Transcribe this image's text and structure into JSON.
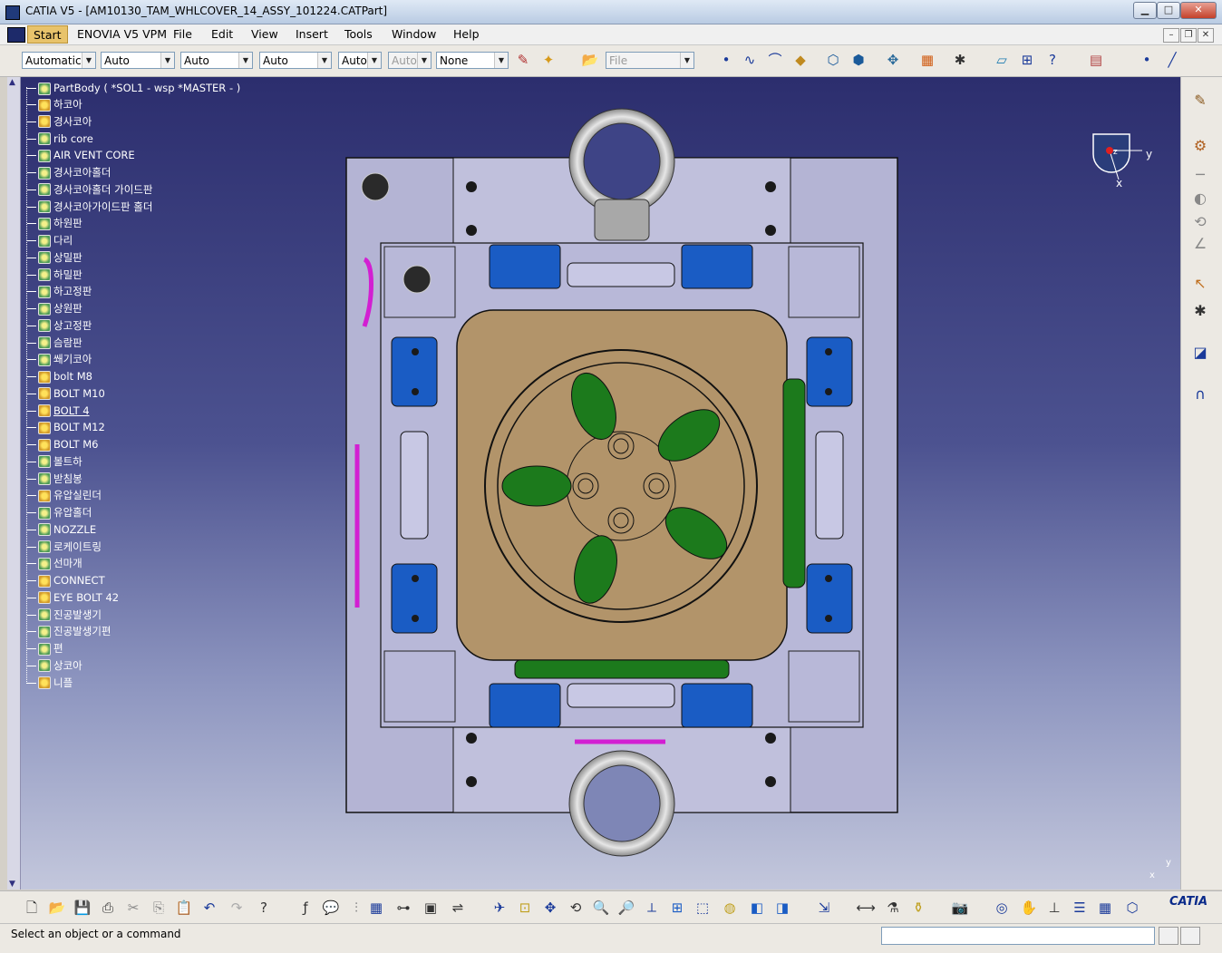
{
  "window": {
    "title": "CATIA V5 - [AM10130_TAM_WHLCOVER_14_ASSY_101224.CATPart]",
    "min_label": "▁",
    "max_label": "□",
    "close_label": "✕"
  },
  "menu": {
    "items": [
      "Start",
      "ENOVIA V5 VPM",
      "File",
      "Edit",
      "View",
      "Insert",
      "Tools",
      "Window",
      "Help"
    ]
  },
  "mdi": {
    "min": "–",
    "restore": "❐",
    "close": "✕"
  },
  "toolbar": {
    "combos": [
      "Automatic",
      "Auto",
      "Auto",
      "Auto",
      "Auto",
      "Auto",
      "None",
      "File"
    ]
  },
  "tree": {
    "root": "PartBody ( *SOL1 - wsp *MASTER -  )",
    "items": [
      {
        "label": "하코아",
        "icon": "yellow"
      },
      {
        "label": "경사코아",
        "icon": "yellow"
      },
      {
        "label": "rib core",
        "icon": "green"
      },
      {
        "label": "AIR VENT CORE",
        "icon": "green"
      },
      {
        "label": "경사코아홀더",
        "icon": "green"
      },
      {
        "label": "경사코아홀더 가이드판",
        "icon": "green"
      },
      {
        "label": "경사코아가이드판 홀더",
        "icon": "green"
      },
      {
        "label": "하원판",
        "icon": "green"
      },
      {
        "label": "다리",
        "icon": "green"
      },
      {
        "label": "상밀판",
        "icon": "green"
      },
      {
        "label": "하밀판",
        "icon": "green"
      },
      {
        "label": "하고정판",
        "icon": "green"
      },
      {
        "label": "상원판",
        "icon": "green"
      },
      {
        "label": "상고정판",
        "icon": "green"
      },
      {
        "label": "슴람판",
        "icon": "green"
      },
      {
        "label": "쐐기코아",
        "icon": "green"
      },
      {
        "label": "bolt M8",
        "icon": "yellow"
      },
      {
        "label": "BOLT M10",
        "icon": "yellow"
      },
      {
        "label": "BOLT 4",
        "icon": "yellow"
      },
      {
        "label": "BOLT M12",
        "icon": "yellow"
      },
      {
        "label": "BOLT M6",
        "icon": "yellow"
      },
      {
        "label": "볼트하",
        "icon": "green"
      },
      {
        "label": "받침봉",
        "icon": "green"
      },
      {
        "label": "유압실린더",
        "icon": "yellow"
      },
      {
        "label": "유압홀더",
        "icon": "green"
      },
      {
        "label": "NOZZLE",
        "icon": "green"
      },
      {
        "label": "로케이트링",
        "icon": "green"
      },
      {
        "label": "선마개",
        "icon": "green"
      },
      {
        "label": "CONNECT",
        "icon": "yellow"
      },
      {
        "label": "EYE BOLT 42",
        "icon": "yellow"
      },
      {
        "label": "진공발생기",
        "icon": "green"
      },
      {
        "label": "진공발생기편",
        "icon": "green"
      },
      {
        "label": "편",
        "icon": "green"
      },
      {
        "label": "상코아",
        "icon": "green"
      },
      {
        "label": "니플",
        "icon": "yellow"
      }
    ]
  },
  "compass": {
    "y": "y",
    "x": "x",
    "z": "z"
  },
  "axes": {
    "y": "y",
    "x": "x"
  },
  "status": {
    "message": "Select an object or a command"
  },
  "logo": {
    "text": "CATIA"
  },
  "colors": {
    "viewport_top": "#2c2e6e",
    "viewport_bottom": "#c3c7dc",
    "plate": "#b4b4d4",
    "cavity": "#b2946a",
    "insert_green": "#1c7a1c",
    "insert_blue": "#1a5cc4",
    "hose": "#d21fd2"
  }
}
